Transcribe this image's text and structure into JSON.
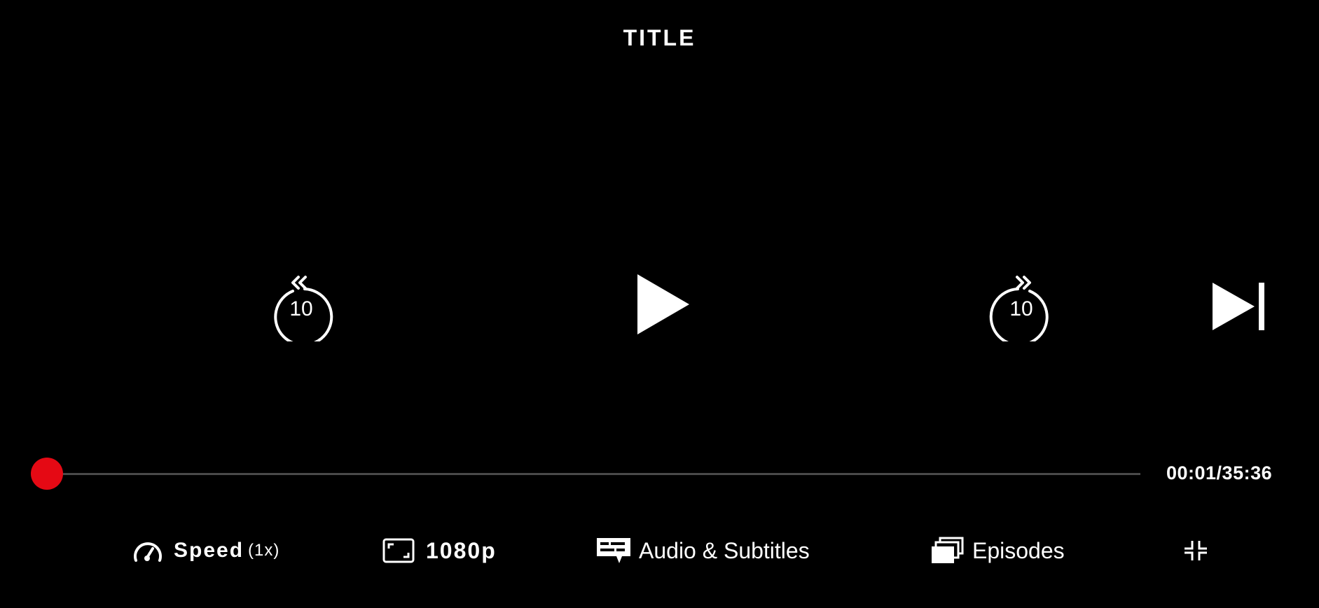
{
  "header": {
    "title": "TITLE"
  },
  "controls": {
    "rewind": {
      "icon": "rewind-10-icon",
      "seconds": "10"
    },
    "play": {
      "icon": "play-icon"
    },
    "forward": {
      "icon": "forward-10-icon",
      "seconds": "10"
    },
    "next": {
      "icon": "next-episode-icon"
    }
  },
  "progress": {
    "current": "00:01",
    "duration": "35:36",
    "time_text": "00:01/35:36",
    "fraction": 0.0005
  },
  "bottom_bar": {
    "speed": {
      "label": "Speed",
      "value": "(1x)",
      "icon": "speedometer-icon"
    },
    "quality": {
      "label": "1080p",
      "icon": "aspect-ratio-icon"
    },
    "audio": {
      "label": "Audio & Subtitles",
      "icon": "subtitles-icon"
    },
    "episodes": {
      "label": "Episodes",
      "icon": "episodes-stack-icon"
    },
    "exit_fullscreen": {
      "icon": "exit-fullscreen-icon"
    }
  },
  "colors": {
    "background": "#000000",
    "accent": "#e50914",
    "track": "#4a4a4a",
    "foreground": "#ffffff"
  }
}
